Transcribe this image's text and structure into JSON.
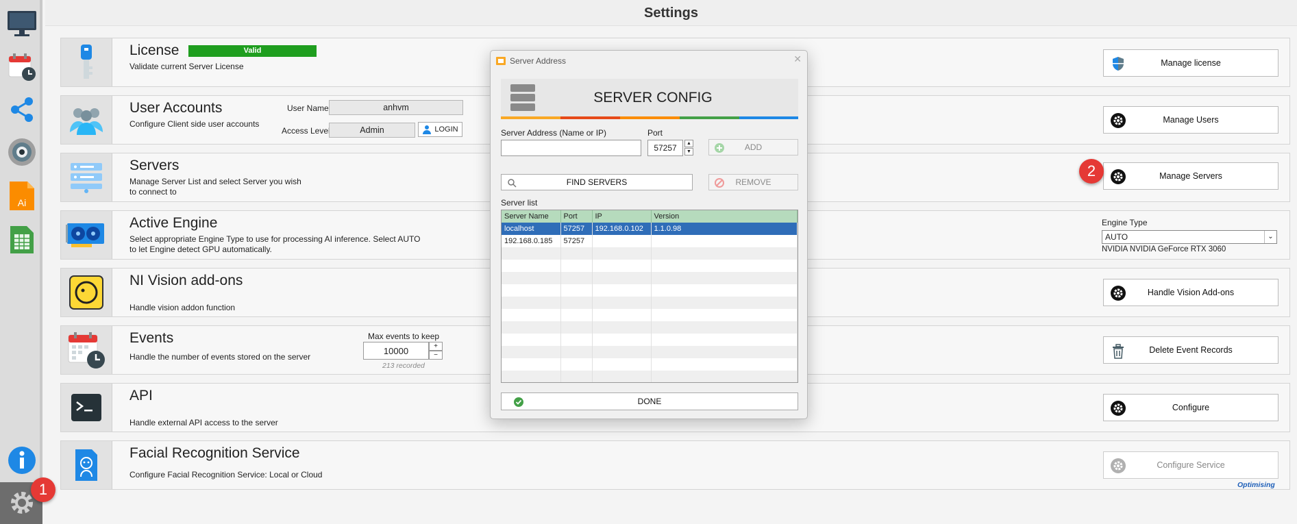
{
  "header": {
    "title": "Settings"
  },
  "rail": {
    "items": [
      "monitor-icon",
      "calendar-clock-icon",
      "share-icon",
      "camera-icon",
      "ai-file-icon",
      "spreadsheet-icon",
      "info-icon",
      "settings-gear-icon"
    ],
    "callout": "1"
  },
  "rows": {
    "license": {
      "title": "License",
      "badge": "Valid",
      "desc": "Validate current Server License",
      "button": "Manage license"
    },
    "users": {
      "title": "User Accounts",
      "desc": "Configure Client side user accounts",
      "username_label": "User Name",
      "username_value": "anhvm",
      "access_label": "Access Level",
      "access_value": "Admin",
      "login": "LOGIN",
      "button": "Manage Users"
    },
    "servers": {
      "title": "Servers",
      "desc1": "Manage Server List and select Server you wish",
      "desc2": "to connect to",
      "button": "Manage Servers",
      "callout": "2"
    },
    "engine": {
      "title": "Active Engine",
      "desc1": "Select appropriate Engine Type to use for processing AI inference. Select AUTO",
      "desc2": "to let Engine detect GPU automatically.",
      "engine_label": "Engine Type",
      "engine_value": "AUTO",
      "gpu": "NVIDIA NVIDIA GeForce RTX 3060"
    },
    "vision": {
      "title": "NI Vision add-ons",
      "desc": "Handle vision addon function",
      "button": "Handle Vision Add-ons"
    },
    "events": {
      "title": "Events",
      "desc": "Handle the number of events stored on the server",
      "max_label": "Max events to keep",
      "max_value": "10000",
      "recorded": "213 recorded",
      "button": "Delete Event Records"
    },
    "api": {
      "title": "API",
      "desc": "Handle external API access to the server",
      "button": "Configure"
    },
    "facial": {
      "title": "Facial Recognition Service",
      "desc": "Configure Facial Recognition Service: Local or Cloud",
      "button": "Configure Service",
      "status": "Optimising"
    }
  },
  "dialog": {
    "title": "Server Address",
    "banner": "SERVER CONFIG",
    "address_label": "Server Address (Name or IP)",
    "address_value": "",
    "port_label": "Port",
    "port_value": "57257",
    "add": "ADD",
    "find": "FIND SERVERS",
    "remove": "REMOVE",
    "list_label": "Server list",
    "columns": [
      "Server Name",
      "Port",
      "IP",
      "Version"
    ],
    "rows": [
      [
        "localhost",
        "57257",
        "192.168.0.102",
        "1.1.0.98"
      ],
      [
        "192.168.0.185",
        "57257",
        "",
        ""
      ]
    ],
    "done": "DONE"
  },
  "colors": {
    "accent_green": "#1f9e1f",
    "selection_blue": "#2f6db8",
    "grid_header": "#b6dbbd",
    "callout_red": "#e53935"
  }
}
